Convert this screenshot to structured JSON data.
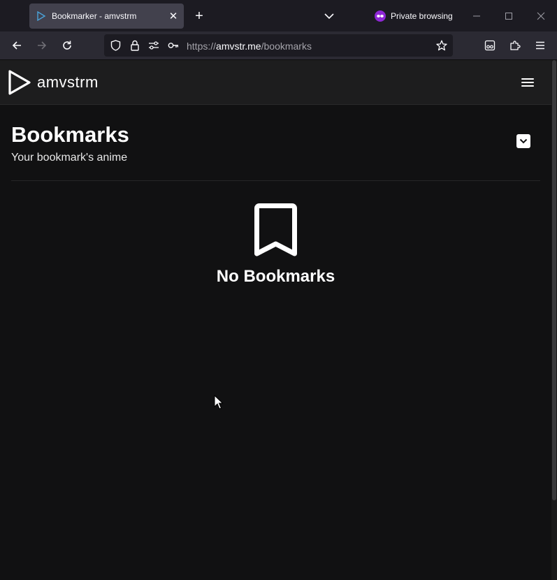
{
  "browser": {
    "tab_title": "Bookmarker - amvstrm",
    "private_label": "Private browsing",
    "url_scheme": "https://",
    "url_host": "amvstr.me",
    "url_path": "/bookmarks"
  },
  "site": {
    "brand": "amvstrm"
  },
  "page": {
    "title": "Bookmarks",
    "subtitle": "Your bookmark's anime",
    "empty_message": "No Bookmarks"
  },
  "colors": {
    "background": "#111112",
    "header": "#1d1d1e",
    "private_accent": "#8f27d6"
  },
  "icons": [
    "play-logo-icon",
    "hamburger-menu-icon",
    "chevron-down-icon",
    "bookmark-icon"
  ]
}
